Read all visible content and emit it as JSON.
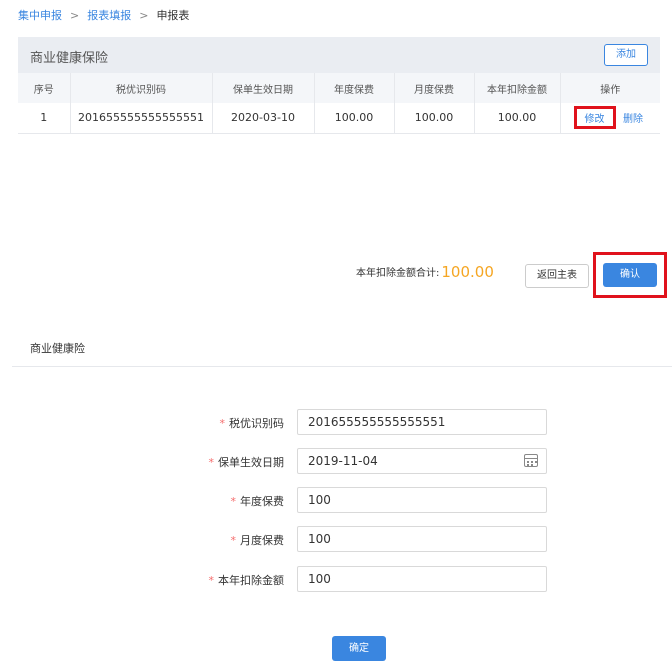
{
  "breadcrumb": {
    "items": [
      "集中申报",
      "报表填报",
      "申报表"
    ],
    "separator": ">"
  },
  "panel": {
    "title": "商业健康保险",
    "add_label": "添加"
  },
  "table": {
    "headers": [
      "序号",
      "税优识别码",
      "保单生效日期",
      "年度保费",
      "月度保费",
      "本年扣除金额",
      "操作"
    ],
    "rows": [
      {
        "index": "1",
        "code": "201655555555555551",
        "effective_date": "2020-03-10",
        "annual_premium": "100.00",
        "monthly_premium": "100.00",
        "deduction": "100.00",
        "edit_label": "修改",
        "delete_label": "删除"
      }
    ]
  },
  "summary": {
    "label": "本年扣除金额合计:",
    "amount": "100.00",
    "back_label": "返回主表",
    "confirm_label": "确认"
  },
  "form": {
    "section_title": "商业健康险",
    "fields": [
      {
        "label": "税优识别码",
        "value": "201655555555555551"
      },
      {
        "label": "保单生效日期",
        "value": "2019-11-04"
      },
      {
        "label": "年度保费",
        "value": "100"
      },
      {
        "label": "月度保费",
        "value": "100"
      },
      {
        "label": "本年扣除金额",
        "value": "100"
      }
    ],
    "required_mark": "*",
    "submit_label": "确定"
  },
  "colors": {
    "accent": "#3a86e0",
    "highlight": "#e0121c",
    "amount": "#f5a623",
    "required": "#f56c6c"
  }
}
